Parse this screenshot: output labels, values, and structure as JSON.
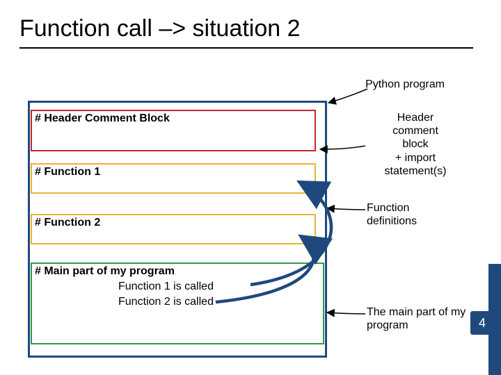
{
  "title": "Function call –> situation 2",
  "labels": {
    "python_program": "Python program",
    "header_comment_block": "# Header Comment Block",
    "function_1": "# Function 1",
    "function_2": "# Function 2",
    "main_heading": "# Main part of my program",
    "main_call_1": "Function 1 is called",
    "main_call_2": "Function 2 is called"
  },
  "annotations": {
    "header_block": "Header comment block + import statement(s)",
    "function_definitions": "Function definitions",
    "main_part": "The main part of my program"
  },
  "slide_number": "4",
  "colors": {
    "accent": "#1f497d",
    "header_box": "#c0272d",
    "function_box": "#e9b432",
    "main_box": "#2f9a4a"
  }
}
